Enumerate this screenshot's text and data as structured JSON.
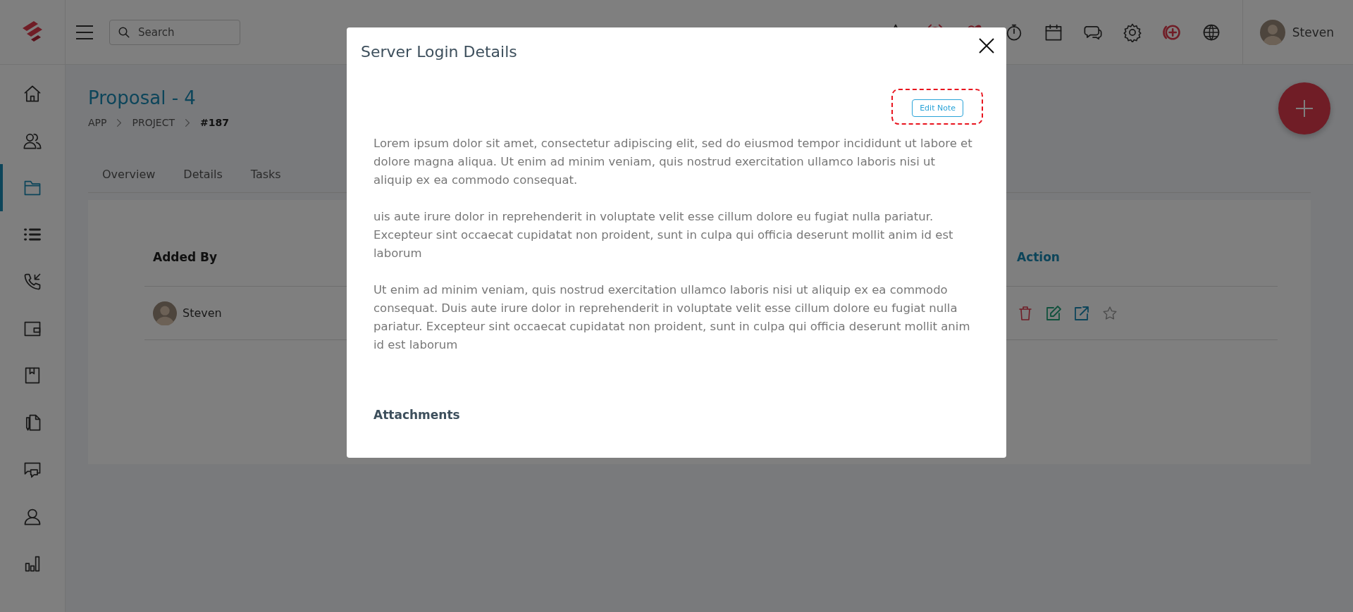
{
  "header": {
    "search": {
      "placeholder": "Search"
    },
    "user": {
      "name": "Steven"
    }
  },
  "sidebar": {
    "items": [
      {
        "selected": false
      },
      {
        "selected": false
      },
      {
        "selected": true
      },
      {
        "selected": false
      },
      {
        "selected": false
      },
      {
        "selected": false
      },
      {
        "selected": false
      },
      {
        "selected": false
      },
      {
        "selected": false
      },
      {
        "selected": false
      },
      {
        "selected": false
      }
    ]
  },
  "page": {
    "title": "Proposal - 4",
    "breadcrumb": [
      "APP",
      "PROJECT",
      "#187"
    ],
    "tabs": [
      {
        "label": "Overview",
        "selected": false
      },
      {
        "label": "Details",
        "selected": false
      },
      {
        "label": "Tasks",
        "selected": false
      }
    ],
    "table": {
      "columns": [
        "Added By",
        "Action"
      ],
      "rows": [
        {
          "added_by": "Steven"
        }
      ]
    }
  },
  "modal": {
    "title": "Server Login Details",
    "edit_button": "Edit Note",
    "paragraphs": [
      "Lorem ipsum dolor sit amet, consectetur adipiscing elit, sed do eiusmod tempor incididunt ut labore et dolore magna aliqua. Ut enim ad minim veniam, quis nostrud exercitation ullamco laboris nisi ut aliquip ex ea commodo consequat.",
      "uis aute irure dolor in reprehenderit in voluptate velit esse cillum dolore eu fugiat nulla pariatur. Excepteur sint occaecat cupidatat non proident, sunt in culpa qui officia deserunt mollit anim id est laborum",
      "Ut enim ad minim veniam, quis nostrud exercitation ullamco laboris nisi ut aliquip ex ea commodo consequat. Duis aute irure dolor in reprehenderit in voluptate velit esse cillum dolore eu fugiat nulla pariatur. Excepteur sint occaecat cupidatat non proident, sunt in culpa qui officia deserunt mollit anim id est laborum"
    ],
    "attachments_heading": "Attachments"
  }
}
